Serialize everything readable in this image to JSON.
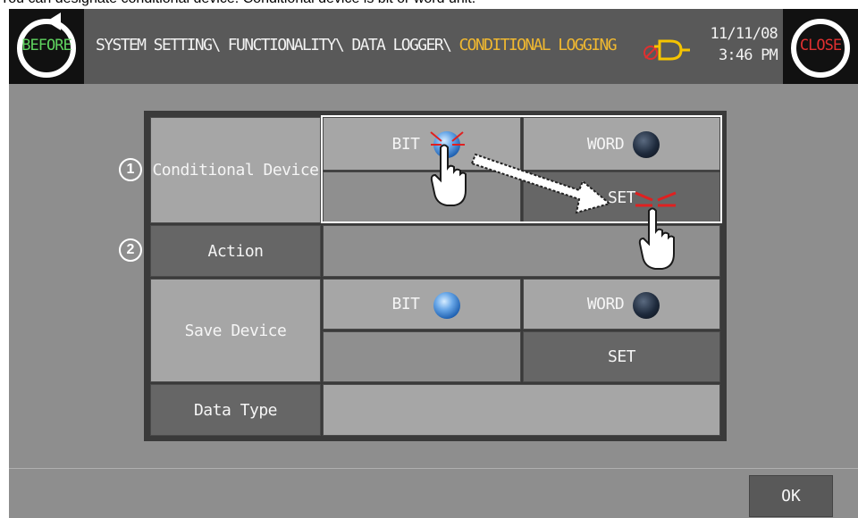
{
  "caption": "You can designate conditional device. Conditional device is bit or word unit.",
  "header": {
    "before_label": "BEFORE",
    "close_label": "CLOSE",
    "breadcrumb_path": "SYSTEM SETTING\\ FUNCTIONALITY\\ DATA LOGGER\\ ",
    "breadcrumb_current": "CONDITIONAL LOGGING",
    "date": "11/11/08",
    "time": "3:46 PM"
  },
  "form": {
    "markers": [
      "1",
      "2"
    ],
    "conditional_device": {
      "label": "Conditional Device",
      "bit_label": "BIT",
      "word_label": "WORD",
      "set_label": "SET",
      "selected": "BIT"
    },
    "action": {
      "label": "Action",
      "value": ""
    },
    "save_device": {
      "label": "Save Device",
      "bit_label": "BIT",
      "word_label": "WORD",
      "set_label": "SET",
      "selected": "BIT"
    },
    "data_type": {
      "label": "Data Type",
      "value": ""
    }
  },
  "footer": {
    "ok_label": "OK"
  },
  "colors": {
    "header_bg": "#595959",
    "breadcrumb_current": "#f0b830",
    "before_green": "#5fd35f",
    "close_red": "#e03030",
    "panel_bg": "#8e8e8e"
  },
  "icons": [
    "before-icon",
    "close-icon",
    "alarm-bell-icon",
    "radio-icon",
    "pointer-hand-icon",
    "arrow-icon"
  ]
}
